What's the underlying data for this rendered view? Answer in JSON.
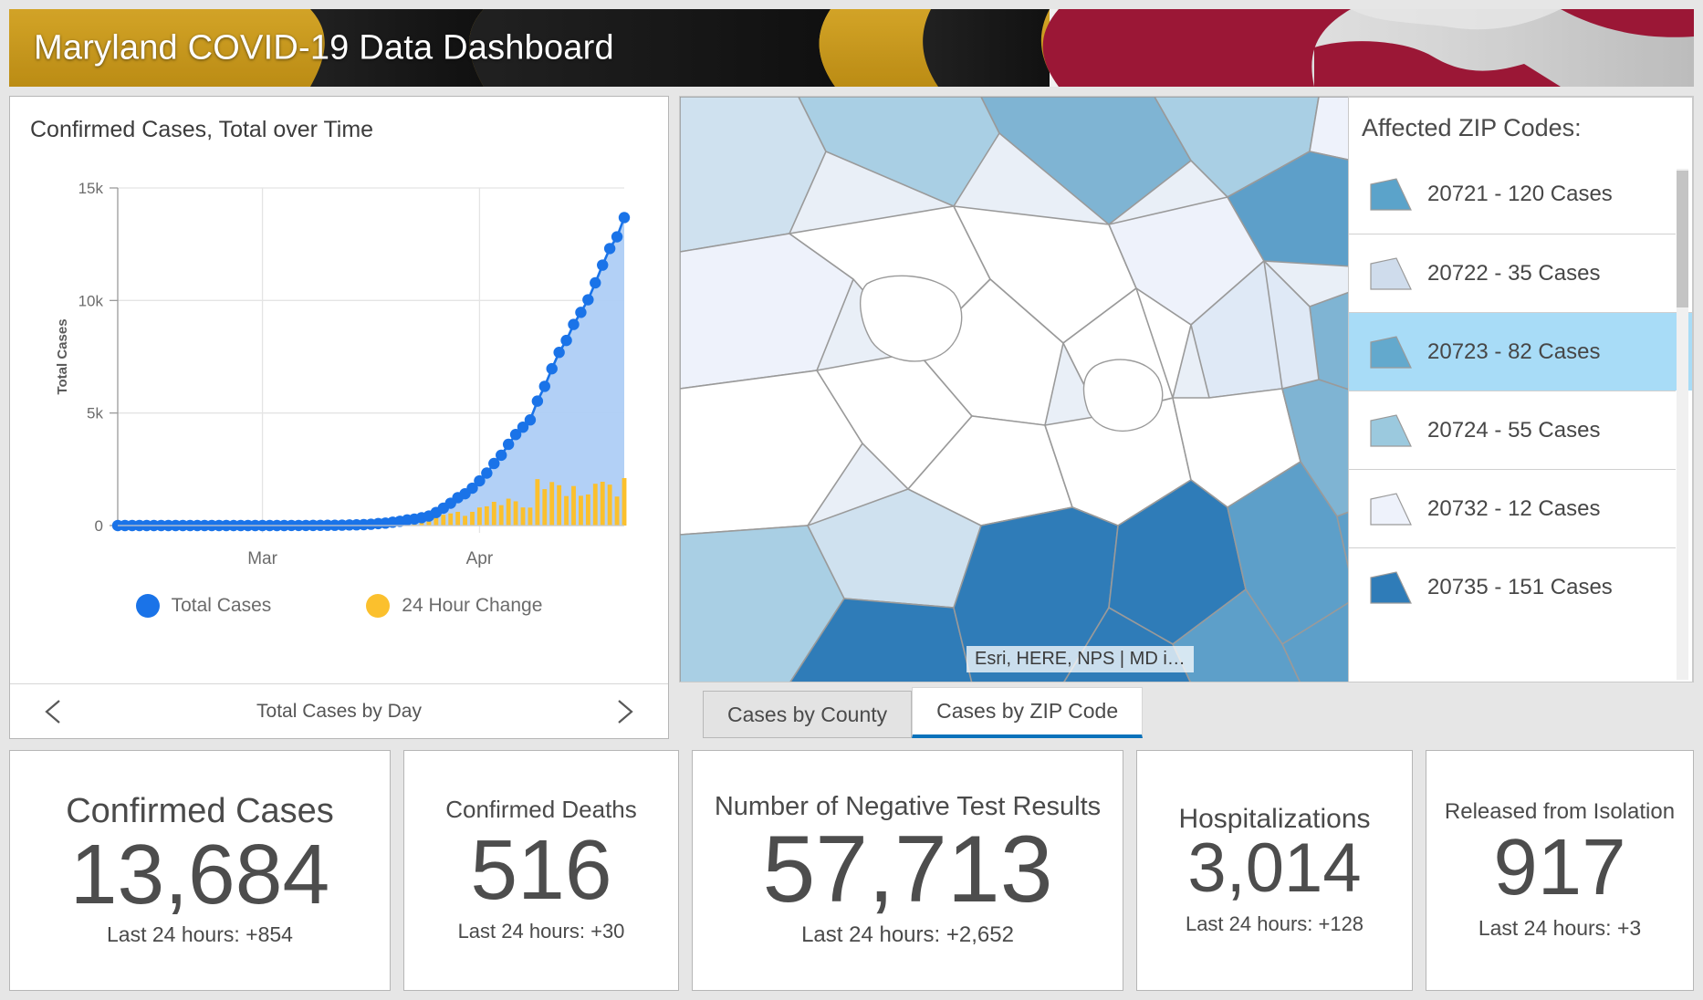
{
  "header": {
    "title": "Maryland COVID-19 Data Dashboard",
    "flag_colors": {
      "gold": "#d8a520",
      "black": "#1a1a1a",
      "red": "#a5193a",
      "white": "#f2f2f2"
    }
  },
  "chart_panel": {
    "title": "Confirmed Cases, Total over Time",
    "footer_label": "Total Cases by Day",
    "prev_arrow_icon": "triangle-left-icon",
    "next_arrow_icon": "triangle-right-icon",
    "legend": [
      {
        "label": "Total Cases",
        "color": "#1a73e8"
      },
      {
        "label": "24 Hour Change",
        "color": "#fbc02d"
      }
    ]
  },
  "chart_data": {
    "type": "line",
    "title": "Confirmed Cases, Total over Time",
    "xlabel": "",
    "ylabel": "Total Cases",
    "ylim": [
      0,
      15000
    ],
    "yticks": [
      0,
      5000,
      10000,
      15000
    ],
    "ytick_labels": [
      "0",
      "5k",
      "10k",
      "15k"
    ],
    "xticks": [
      "Mar",
      "Apr"
    ],
    "grid": true,
    "legend_position": "bottom",
    "x": [
      "2020-02-10",
      "2020-02-11",
      "2020-02-12",
      "2020-02-13",
      "2020-02-14",
      "2020-02-15",
      "2020-02-16",
      "2020-02-17",
      "2020-02-18",
      "2020-02-19",
      "2020-02-20",
      "2020-02-21",
      "2020-02-22",
      "2020-02-23",
      "2020-02-24",
      "2020-02-25",
      "2020-02-26",
      "2020-02-27",
      "2020-02-28",
      "2020-02-29",
      "2020-03-01",
      "2020-03-02",
      "2020-03-03",
      "2020-03-04",
      "2020-03-05",
      "2020-03-06",
      "2020-03-07",
      "2020-03-08",
      "2020-03-09",
      "2020-03-10",
      "2020-03-11",
      "2020-03-12",
      "2020-03-13",
      "2020-03-14",
      "2020-03-15",
      "2020-03-16",
      "2020-03-17",
      "2020-03-18",
      "2020-03-19",
      "2020-03-20",
      "2020-03-21",
      "2020-03-22",
      "2020-03-23",
      "2020-03-24",
      "2020-03-25",
      "2020-03-26",
      "2020-03-27",
      "2020-03-28",
      "2020-03-29",
      "2020-03-30",
      "2020-03-31",
      "2020-04-01",
      "2020-04-02",
      "2020-04-03",
      "2020-04-04",
      "2020-04-05",
      "2020-04-06",
      "2020-04-07",
      "2020-04-08",
      "2020-04-09",
      "2020-04-10",
      "2020-04-11",
      "2020-04-12",
      "2020-04-13",
      "2020-04-14",
      "2020-04-15",
      "2020-04-16",
      "2020-04-17",
      "2020-04-18",
      "2020-04-19",
      "2020-04-20"
    ],
    "series": [
      {
        "name": "Total Cases",
        "type": "line",
        "color": "#1a73e8",
        "fill_color": "#aecdf6",
        "values": [
          0,
          0,
          0,
          0,
          0,
          0,
          0,
          0,
          0,
          0,
          0,
          0,
          0,
          0,
          0,
          0,
          0,
          0,
          0,
          0,
          0,
          0,
          0,
          0,
          3,
          3,
          3,
          5,
          8,
          12,
          12,
          17,
          26,
          32,
          41,
          57,
          86,
          107,
          149,
          190,
          248,
          288,
          349,
          423,
          580,
          774,
          992,
          1239,
          1413,
          1660,
          1985,
          2331,
          2758,
          3125,
          3609,
          4045,
          4371,
          4694,
          5529,
          6185,
          6968,
          7694,
          8225,
          8936,
          9472,
          10032,
          10784,
          11572,
          12308,
          12830,
          13684
        ]
      },
      {
        "name": "24 Hour Change",
        "type": "bar",
        "color": "#fbc02d",
        "values": [
          0,
          0,
          0,
          0,
          0,
          0,
          0,
          0,
          0,
          0,
          0,
          0,
          0,
          0,
          0,
          0,
          0,
          0,
          0,
          0,
          0,
          0,
          0,
          0,
          3,
          0,
          0,
          2,
          3,
          4,
          0,
          5,
          9,
          6,
          9,
          16,
          29,
          21,
          42,
          41,
          58,
          40,
          61,
          74,
          157,
          194,
          218,
          247,
          174,
          247,
          325,
          346,
          427,
          367,
          484,
          436,
          326,
          323,
          835,
          656,
          783,
          726,
          531,
          711,
          536,
          560,
          752,
          788,
          736,
          522,
          854
        ]
      }
    ]
  },
  "map": {
    "dots_button_icon": "ellipsis-icon",
    "zoom_in_label": "+",
    "zoom_out_label": "−",
    "attribution": "Esri, HERE, NPS | MD i…",
    "tabs": [
      {
        "label": "Cases by County",
        "active": false
      },
      {
        "label": "Cases by ZIP Code",
        "active": true
      }
    ],
    "active_tab_underline_color": "#0a72bb",
    "choropleth_colors": [
      "#ffffff",
      "#eef2fb",
      "#dfe9f6",
      "#cfe1ef",
      "#a9cfe4",
      "#7fb4d3",
      "#5d9fc9",
      "#2f7cb8"
    ]
  },
  "zip_panel": {
    "title": "Affected ZIP Codes:",
    "rows": [
      {
        "label": "20721 - 120 Cases",
        "swatch": "#5ba3ca",
        "selected": false
      },
      {
        "label": "20722 - 35 Cases",
        "swatch": "#cfdcec",
        "selected": false
      },
      {
        "label": "20723 - 82 Cases",
        "swatch": "#63a9cd",
        "selected": true
      },
      {
        "label": "20724 - 55 Cases",
        "swatch": "#9bc9de",
        "selected": false
      },
      {
        "label": "20732 - 12 Cases",
        "swatch": "#eef2fb",
        "selected": false
      },
      {
        "label": "20735 - 151 Cases",
        "swatch": "#2f7cb8",
        "selected": false
      }
    ]
  },
  "cards": [
    {
      "title": "Confirmed Cases",
      "value": "13,684",
      "sub": "Last 24 hours: +854"
    },
    {
      "title": "Confirmed Deaths",
      "value": "516",
      "sub": "Last 24 hours: +30"
    },
    {
      "title": "Number of Negative Test Results",
      "value": "57,713",
      "sub": "Last 24 hours: +2,652"
    },
    {
      "title": "Hospitalizations",
      "value": "3,014",
      "sub": "Last 24 hours: +128"
    },
    {
      "title": "Released from Isolation",
      "value": "917",
      "sub": "Last 24 hours: +3"
    }
  ]
}
